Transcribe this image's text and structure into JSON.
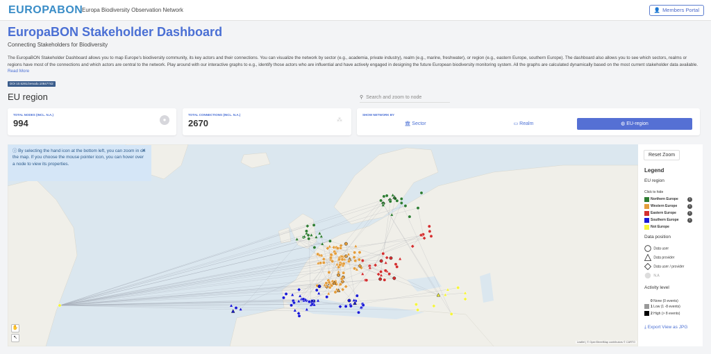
{
  "header": {
    "logo": "EUROPABON",
    "subtitle": "Europa Biodiversity Observation Network",
    "members_portal": "Members Portal"
  },
  "page": {
    "title": "EuropaBON Stakeholder Dashboard",
    "subtitle": "Connecting Stakeholders for Biodiversity",
    "intro": "The EuropaBON Stakeholder Dashboard allows you to map Europe's biodiversity community, its key actors and their connections. You can visualize the network by sector (e.g., academia, private industry), realm (e.g., marine, freshwater), or region (e.g., eastern Europe, southern Europe). The dashboard also allows you to see which sectors, realms or regions have most of the connections and which actors are central to the network. Play around with our interactive graphs to e.g., identify those actors who are influential and have actively engaged in designing the future European biodiversity monitoring system. All the graphs are calculated dynamically based on the most current stakeholder data available.",
    "read_more": "Read More",
    "doi": "DOI 10.5281/zenodo.10847742",
    "section_title": "EU region",
    "search_placeholder": "Search and zoom to node"
  },
  "stats": {
    "total_nodes_label": "TOTAL NODES (INCL. N.A.)",
    "total_nodes_value": "994",
    "total_connections_label": "TOTAL CONNECTIONS (INCL. N.A.)",
    "total_connections_value": "2670"
  },
  "show_network": {
    "label": "SHOW NETWORK BY",
    "options": [
      "Sector",
      "Realm",
      "EU-region"
    ],
    "selected": "EU-region"
  },
  "info_box": {
    "text": "By selecting the hand icon at the bottom left, you can zoom in on the map. If you choose the mouse pointer icon, you can hover over a node to view its properties."
  },
  "map": {
    "attribution": "Leaflet | © OpenStreetMap contributors © CARTO",
    "tools": [
      "hand-icon",
      "pointer-icon"
    ]
  },
  "legend": {
    "reset_zoom": "Reset Zoom",
    "title": "Legend",
    "region_title": "EU region",
    "click_to_hide": "Click to hide",
    "regions": [
      {
        "label": "Northern Europe",
        "color": "#2e7d32"
      },
      {
        "label": "Western Europe",
        "color": "#e39d3c"
      },
      {
        "label": "Eastern Europe",
        "color": "#d32f2f"
      },
      {
        "label": "Southern Europe",
        "color": "#1a1ad6"
      },
      {
        "label": "Not Europe",
        "color": "#f5f53a"
      }
    ],
    "data_position_title": "Data position",
    "positions": [
      "Data user",
      "Data provider",
      "Data user / provider",
      "N.A"
    ],
    "activity_title": "Activity level",
    "activity": [
      {
        "level": "0",
        "text": "None (0 events)",
        "color": "#ffffff"
      },
      {
        "level": "1",
        "text": "Low (1 -8 events)",
        "color": "#999999"
      },
      {
        "level": "2",
        "text": "High (> 8 events)",
        "color": "#000000"
      }
    ],
    "export": "Export View as JPG"
  },
  "colors": {
    "accent": "#4a6fd4",
    "map_water": "#dbe7ef",
    "map_land": "#f0efe9"
  }
}
